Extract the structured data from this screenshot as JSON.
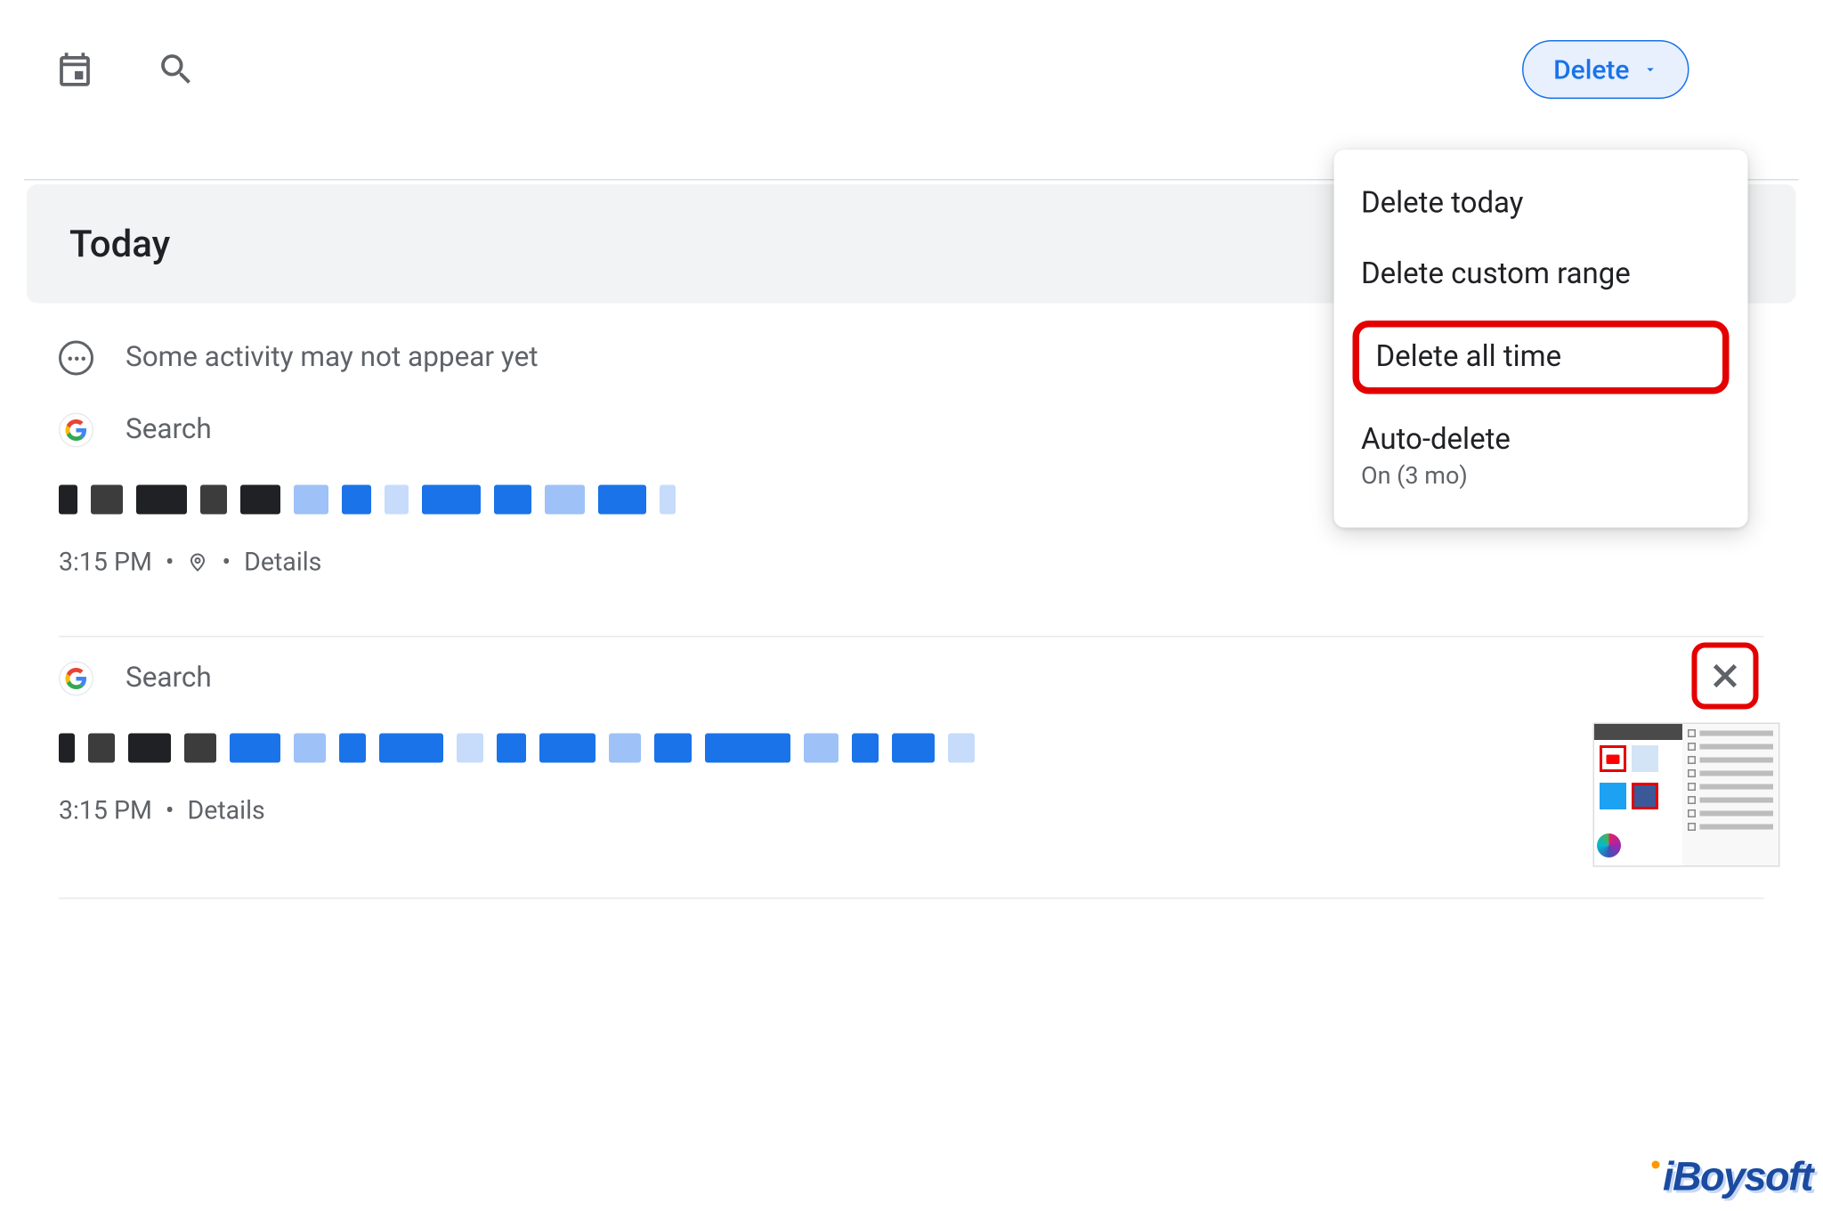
{
  "topbar": {
    "delete_label": "Delete"
  },
  "section": {
    "today": "Today"
  },
  "notice": "Some activity may not appear yet",
  "items": [
    {
      "source": "Search",
      "time": "3:15 PM",
      "details_label": "Details",
      "has_location": true
    },
    {
      "source": "Search",
      "time": "3:15 PM",
      "details_label": "Details",
      "has_location": false
    }
  ],
  "dropdown": {
    "items": [
      {
        "label": "Delete today"
      },
      {
        "label": "Delete custom range"
      },
      {
        "label": "Delete all time",
        "highlighted": true
      },
      {
        "label": "Auto-delete",
        "sub": "On (3 mo)"
      }
    ]
  },
  "watermark": "iBoysoft"
}
